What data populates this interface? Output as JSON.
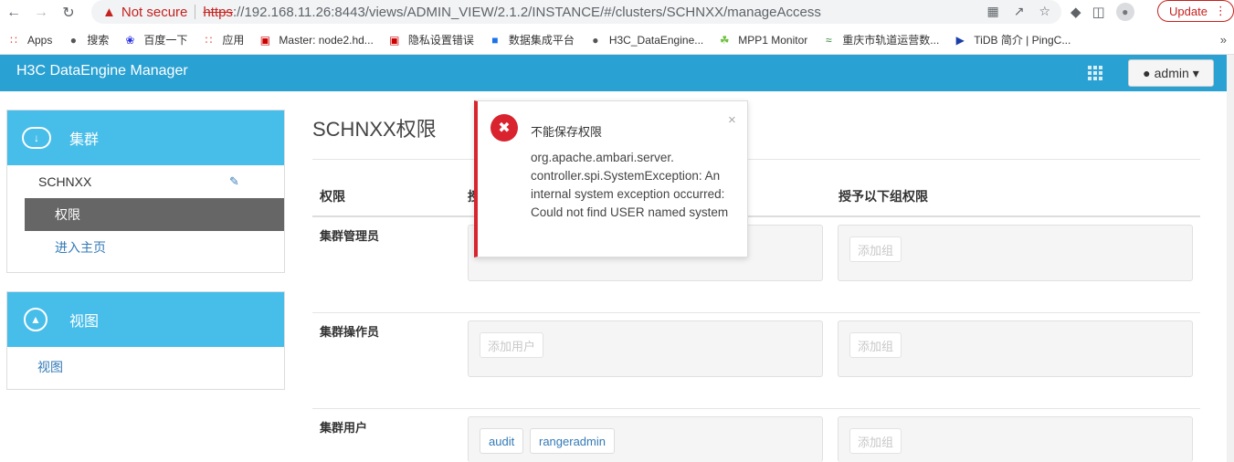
{
  "browser": {
    "not_secure": "Not secure",
    "url_proto": "https",
    "url_rest": "://192.168.11.26:8443/views/ADMIN_VIEW/2.1.2/INSTANCE/#/clusters/SCHNXX/manageAccess",
    "update_label": "Update",
    "bookmarks": [
      {
        "label": "Apps",
        "icon": "apps-grid-icon",
        "color": "#e8453c"
      },
      {
        "label": "搜索",
        "icon": "globe-icon",
        "color": "#555"
      },
      {
        "label": "百度一下",
        "icon": "baidu-icon",
        "color": "#2932e1"
      },
      {
        "label": "应用",
        "icon": "apps-grid-icon",
        "color": "#e8453c"
      },
      {
        "label": "Master: node2.hd...",
        "icon": "h3c-icon",
        "color": "#c00"
      },
      {
        "label": "隐私设置错误",
        "icon": "h3c-icon",
        "color": "#c00"
      },
      {
        "label": "数据集成平台",
        "icon": "square-icon",
        "color": "#1a73e8"
      },
      {
        "label": "H3C_DataEngine...",
        "icon": "globe-icon",
        "color": "#555"
      },
      {
        "label": "MPP1 Monitor",
        "icon": "leaf-icon",
        "color": "#6cbf3c"
      },
      {
        "label": "重庆市轨道运营数...",
        "icon": "rail-icon",
        "color": "#2e7d32"
      },
      {
        "label": "TiDB 简介 | PingC...",
        "icon": "tidb-icon",
        "color": "#1a3ea8"
      }
    ],
    "more": "»"
  },
  "app": {
    "brand": "H3C DataEngine Manager",
    "user": "admin"
  },
  "sidebar": {
    "clusters_title": "集群",
    "cluster_name": "SCHNXX",
    "active_item": "权限",
    "home_link": "进入主页",
    "views_title": "视图",
    "views_link": "视图"
  },
  "main": {
    "title": "SCHNXX权限",
    "col_permission": "权限",
    "col_users_partial": "授",
    "col_groups": "授予以下组权限",
    "rows": [
      {
        "label": "集群管理员",
        "user_placeholder": "",
        "group_placeholder": "添加组",
        "users": []
      },
      {
        "label": "集群操作员",
        "user_placeholder": "添加用户",
        "group_placeholder": "添加组",
        "users": []
      },
      {
        "label": "集群用户",
        "user_placeholder": "",
        "group_placeholder": "添加组",
        "users": [
          "audit",
          "rangeradmin"
        ]
      }
    ]
  },
  "toast": {
    "title": "不能保存权限",
    "message": "org.apache.ambari.server.\ncontroller.spi.SystemException: An internal system exception occurred: Could not find USER named system",
    "close": "×",
    "color": "#d9232e"
  }
}
